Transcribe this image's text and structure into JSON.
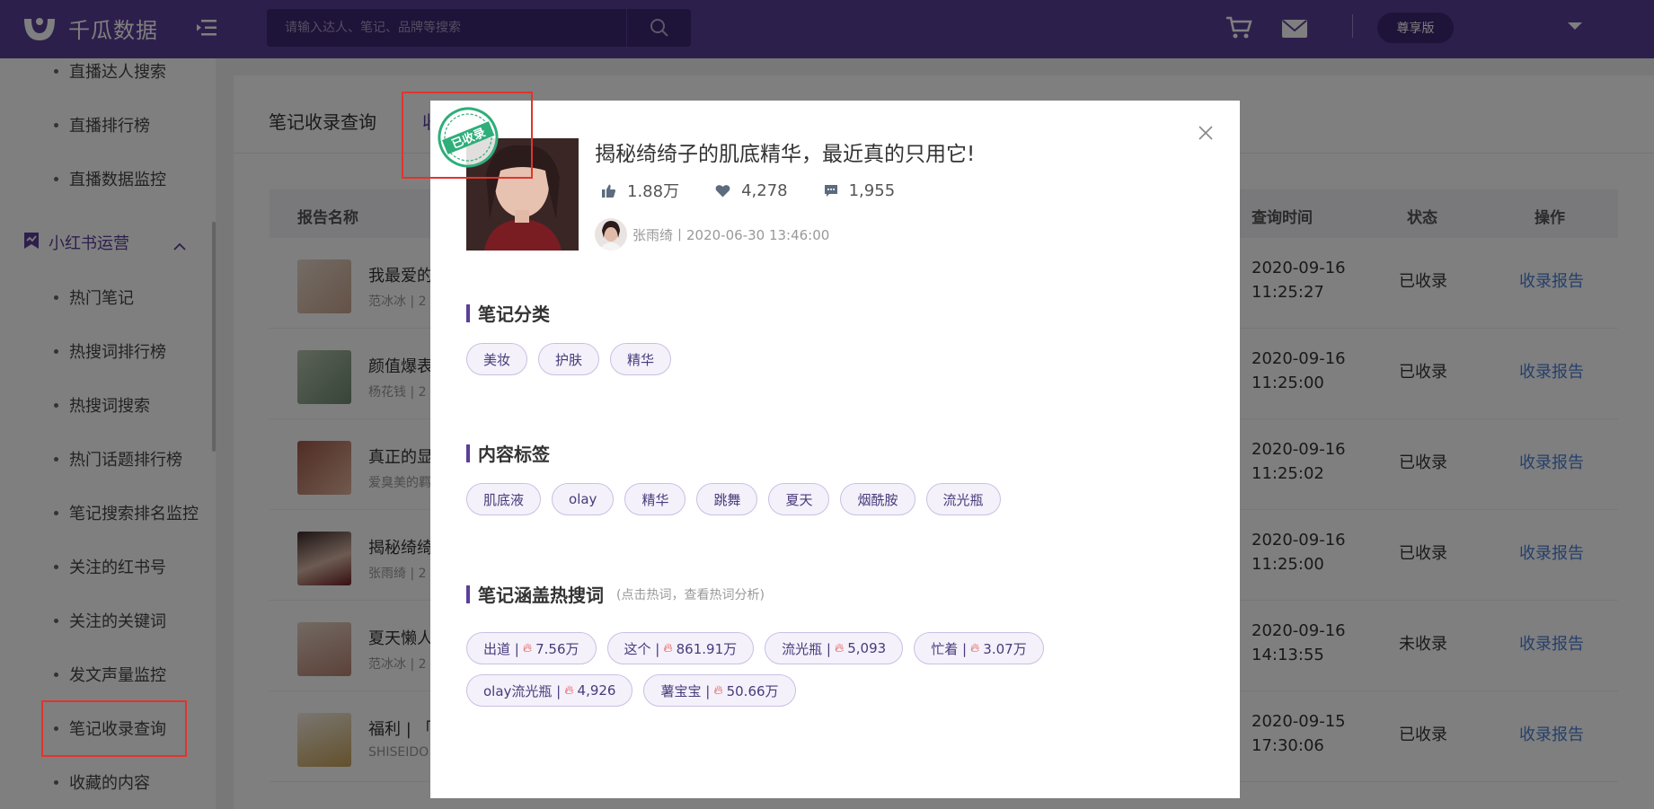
{
  "header": {
    "logo_text": "千瓜数据",
    "search_placeholder": "请输入达人、笔记、品牌等搜索",
    "plan_label": "尊享版"
  },
  "sidebar": {
    "items_top": [
      {
        "label": "直播达人搜索"
      },
      {
        "label": "直播排行榜"
      },
      {
        "label": "直播数据监控"
      }
    ],
    "group_label": "小红书运营",
    "items": [
      {
        "label": "热门笔记"
      },
      {
        "label": "热搜词排行榜"
      },
      {
        "label": "热搜词搜索"
      },
      {
        "label": "热门话题排行榜"
      },
      {
        "label": "笔记搜索排名监控"
      },
      {
        "label": "关注的红书号"
      },
      {
        "label": "关注的关键词"
      },
      {
        "label": "发文声量监控"
      },
      {
        "label": "笔记收录查询"
      },
      {
        "label": "收藏的内容"
      }
    ]
  },
  "main": {
    "tabs": [
      {
        "label": "笔记收录查询"
      },
      {
        "label": "收"
      }
    ],
    "table": {
      "headers": {
        "name": "报告名称",
        "time": "查询时间",
        "status": "状态",
        "action": "操作"
      },
      "rows": [
        {
          "title": "我最爱的",
          "sub": "范冰冰 | 2",
          "time": "2020-09-16\n11:25:27",
          "status": "已收录",
          "action": "收录报告"
        },
        {
          "title": "颜值爆表",
          "sub": "杨花钱 | 2",
          "time": "2020-09-16\n11:25:00",
          "status": "已收录",
          "action": "收录报告"
        },
        {
          "title": "真正的显",
          "sub": "爱臭美的羁",
          "time": "2020-09-16\n11:25:02",
          "status": "已收录",
          "action": "收录报告"
        },
        {
          "title": "揭秘绮绮",
          "sub": "张雨绮 | 2",
          "time": "2020-09-16\n11:25:00",
          "status": "已收录",
          "action": "收录报告"
        },
        {
          "title": "夏天懒人",
          "sub": "范冰冰 | 2",
          "time": "2020-09-16\n14:13:55",
          "status": "未收录",
          "action": "收录报告"
        },
        {
          "title": "福利 | 「",
          "sub": "SHISEIDO",
          "time": "2020-09-15\n17:30:06",
          "status": "已收录",
          "action": "收录报告"
        }
      ]
    }
  },
  "modal": {
    "stamp_text": "已收录",
    "title": "揭秘绮绮子的肌底精华，最近真的只用它!",
    "likes": "1.88万",
    "favorites": "4,278",
    "comments": "1,955",
    "author_line": "张雨绮丨2020-06-30 13:46:00",
    "sections": {
      "category": {
        "title": "笔记分类",
        "tags": [
          "美妆",
          "护肤",
          "精华"
        ]
      },
      "content_tags": {
        "title": "内容标签",
        "tags": [
          "肌底液",
          "olay",
          "精华",
          "跳舞",
          "夏天",
          "烟酰胺",
          "流光瓶"
        ]
      },
      "hot_words": {
        "title": "笔记涵盖热搜词",
        "note": "(点击热词，查看热词分析)",
        "tags": [
          {
            "word": "出道 |",
            "value": "7.56万"
          },
          {
            "word": "这个 |",
            "value": "861.91万"
          },
          {
            "word": "流光瓶 |",
            "value": "5,093"
          },
          {
            "word": "忙着 |",
            "value": "3.07万"
          },
          {
            "word": "olay流光瓶 |",
            "value": "4,926"
          },
          {
            "word": "薯宝宝 |",
            "value": "50.66万"
          }
        ]
      }
    }
  },
  "colors": {
    "brand_purple": "#5b3e99",
    "link_blue": "#4a7fd4",
    "highlight_red": "#e0352c",
    "stamp_green": "#2fae7a"
  }
}
